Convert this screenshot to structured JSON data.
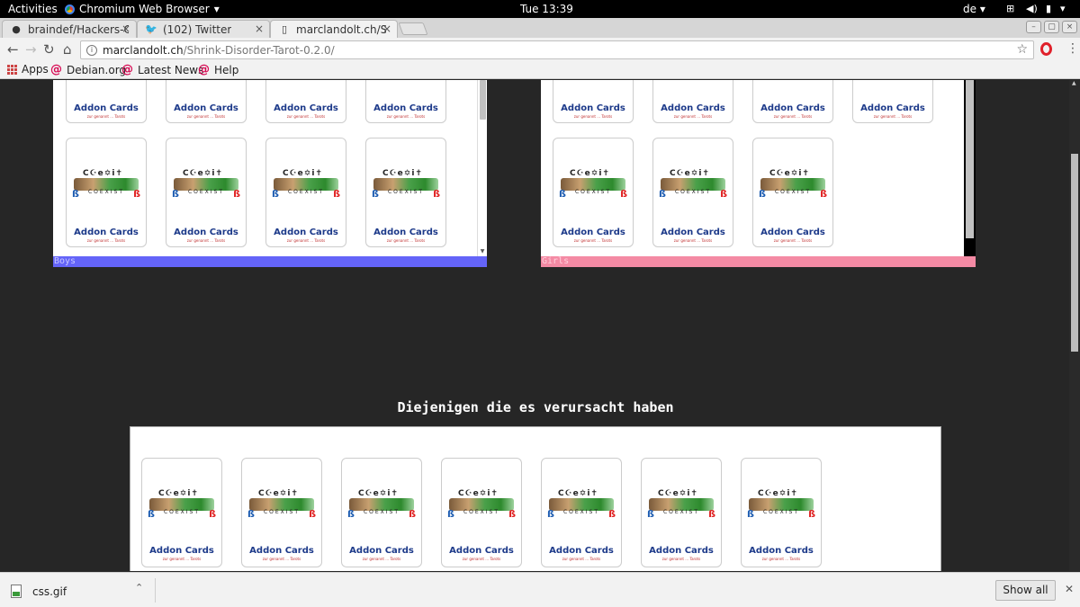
{
  "topbar": {
    "activities": "Activities",
    "app": "Chromium Web Browser",
    "clock": "Tue 13:39",
    "lang": "de"
  },
  "tabs": [
    {
      "title": "braindef/Hackers-Ca",
      "icon": "github-icon"
    },
    {
      "title": "(102) Twitter",
      "icon": "twitter-icon"
    },
    {
      "title": "marclandolt.ch/Shrin",
      "icon": "page-icon"
    }
  ],
  "address": {
    "host": "marclandolt.ch",
    "path": "/Shrink-Disorder-Tarot-0.2.0/"
  },
  "bookmarks": {
    "apps": "Apps",
    "items": [
      "Debian.org",
      "Latest News",
      "Help"
    ]
  },
  "card": {
    "title": "Addon Cards",
    "subtitle": "zur genannt ... Tarots",
    "logo_symbols": "C☪e✡i✝",
    "logo_word": "COEXIST"
  },
  "sections": {
    "boys": "Boys",
    "girls": "Girls",
    "heading": "Diejenigen die es verursacht haben"
  },
  "downloads": {
    "file": "css.gif",
    "show_all": "Show all"
  },
  "colors": {
    "boys_bar": "#6464f8",
    "girls_bar": "#f48aa4",
    "page_bg": "#262626",
    "card_title": "#1d3a8a"
  }
}
